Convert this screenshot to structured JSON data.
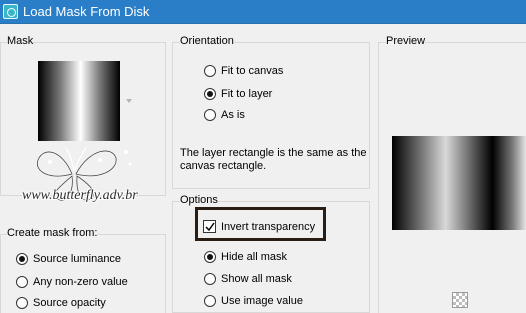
{
  "window": {
    "title": "Load Mask From Disk",
    "icon": "app-icon"
  },
  "mask": {
    "group_label": "Mask",
    "watermark": "www.butterfly.adv.br"
  },
  "orientation": {
    "group_label": "Orientation",
    "options": [
      "Fit to canvas",
      "Fit to layer",
      "As is"
    ],
    "selected": "Fit to layer",
    "info": "The layer rectangle is the same as the canvas rectangle."
  },
  "preview": {
    "group_label": "Preview"
  },
  "options": {
    "group_label": "Options",
    "invert_transparency": {
      "label": "Invert transparency",
      "checked": true
    },
    "radios": [
      "Hide all mask",
      "Show all mask",
      "Use image value"
    ],
    "selected": "Hide all mask"
  },
  "create_mask": {
    "group_label": "Create mask from:",
    "options": [
      "Source luminance",
      "Any non-zero value",
      "Source opacity"
    ],
    "selected": "Source luminance"
  },
  "colors": {
    "titlebar": "#2a7ec7",
    "highlight_box": "#2b1d12",
    "background": "#f0f0f0"
  }
}
